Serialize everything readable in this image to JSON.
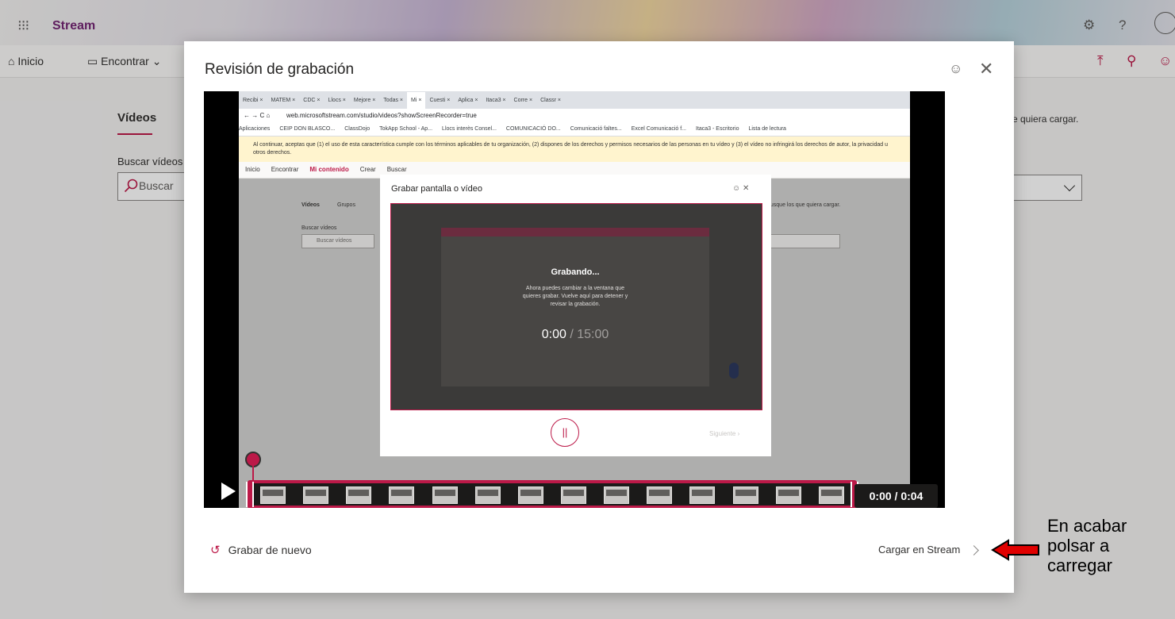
{
  "app": {
    "brand": "Stream",
    "waffle_glyph": "⁝⁝⁝",
    "top_icons": [
      "gear-icon",
      "help-icon",
      "profile-icon"
    ],
    "top_help_glyph": "?"
  },
  "nav": {
    "home": "Inicio",
    "find": "Encontrar",
    "right_icons": [
      "upload-icon",
      "person-icon",
      "feedback-icon"
    ]
  },
  "background_page": {
    "tab": "Vídeos",
    "search_label": "Buscar vídeos",
    "search_placeholder": "Buscar",
    "right_text": "e quiera cargar."
  },
  "modal": {
    "title": "Revisión de grabación",
    "recording": {
      "browser_tabs": [
        "Recibi",
        "MATEM",
        "CDC",
        "Llocs",
        "Mejore",
        "Todas",
        "Mi",
        "Cuesti",
        "Aplica",
        "Itaca3",
        "Corre",
        "Classr"
      ],
      "url": "web.microsoftstream.com/studio/videos?showScreenRecorder=true",
      "bookmarks": [
        "Aplicaciones",
        "CEIP DON BLASCO...",
        "ClassDojo",
        "TokApp School - Ap...",
        "Llocs interès Consel...",
        "COMUNICACIÓ DO...",
        "Comunicació faltes...",
        "Excel Comunicació f...",
        "Itaca3 - Escritorio",
        "Lista de lectura"
      ],
      "notice": "Al continuar, aceptas que (1) el uso de esta característica cumple con los términos aplicables de tu organización, (2) dispones de los derechos y permisos necesarios de las personas en tu vídeo y (3) el vídeo no infringirá los derechos de autor, la privacidad u otros derechos.",
      "inner_nav": [
        "Inicio",
        "Encontrar",
        "Mi contenido",
        "Crear",
        "Buscar"
      ],
      "inner_tabs": [
        "Vídeos",
        "Grupos"
      ],
      "inner_search_label": "Buscar vídeos",
      "inner_search_placeholder": "Buscar vídeos",
      "inner_right_text": "busque los que quiera cargar.",
      "dialog": {
        "title": "Grabar pantalla o vídeo",
        "status": "Grabando...",
        "description": "Ahora puedes cambiar a la ventana que quieres grabar. Vuelve aquí para detener y revisar la grabación.",
        "elapsed": "0:00",
        "total": "/ 15:00",
        "next": "Siguiente"
      }
    },
    "timeline": {
      "thumbnail_count": 14,
      "time": "0:00 / 0:04"
    },
    "redo_label": "Grabar de nuevo",
    "upload_label": "Cargar en Stream"
  },
  "annotation": {
    "lines": [
      "En acabar",
      "polsar a",
      "carregar"
    ],
    "arrow_color": "#e00000"
  },
  "colors": {
    "accent": "#bc1948",
    "brand": "#742774"
  }
}
